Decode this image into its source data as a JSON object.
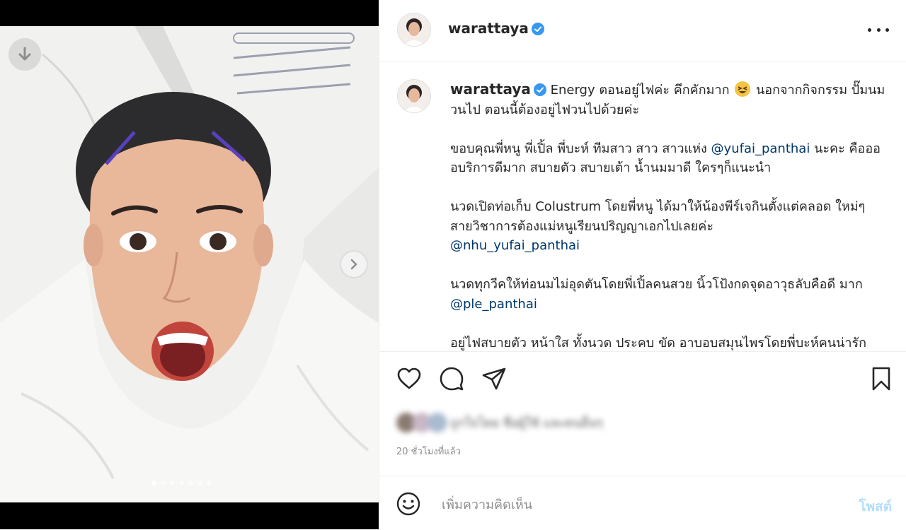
{
  "post": {
    "username": "warattaya",
    "more_label": "More options",
    "caption": {
      "p1_text": "Energy ตอนอยู่ไฟค่ะ คึกคักมาก",
      "p1_text_2": "นอกจากกิจกรรม ปั๊มนมวนไป ตอนนี้ต้องอยู่ไฟวนไปด้วยค่ะ",
      "p2_text": "ขอบคุณพี่หนู พี่เปิ้ล พี่บะห์ ทีมสาว สาว สาวแห่ง",
      "p2_mention": "@yufai_panthai",
      "p2_text_2": "นะคะ คืออออบริการดีมาก สบายตัว สบายเต้า น้ำนมมาดี ใครๆก็แนะนำ",
      "p3_text": "นวดเปิดท่อเก็บ Colustrum โดยพี่หนู ได้มาให้น้องพีร์เจกินตั้งแต่คลอด ใหม่ๆ สายวิชาการต้องแม่หนูเรียนปริญญาเอกไปเลยค่ะ",
      "p3_mention": "@nhu_yufai_panthai",
      "p4_text": "นวดทุกวีคให้ท่อนมไม่อุดตันโดยพี่เปิ้ลคนสวย นิ้วโป้งกดจุดอาวุธลับคือดี มาก",
      "p4_mention": "@ple_panthai",
      "p5_text": "อยู่ไฟสบายตัว หน้าใส ทั้งนวด ประคบ ขัด อาบอบสมุนไพรโดยพี่บะห์คนน่ารัก"
    },
    "likes_text": "ถูกใจโดย ชื่อผู้ใช้ และคนอื่นๆ",
    "timestamp": "20 ชั่วโมงที่แล้ว",
    "comment_placeholder": "เพิ่มความคิดเห็น",
    "post_button": "โพสต์",
    "carousel": {
      "total": 7,
      "active_index": 0
    }
  },
  "colors": {
    "verified": "#3897f0",
    "mention": "#00376b",
    "post_button": "#b2dffc",
    "timestamp": "#8e8e8e"
  },
  "icons": [
    "download-icon",
    "chevron-right-icon",
    "verified-badge-icon",
    "more-icon",
    "heart-icon",
    "comment-icon",
    "share-icon",
    "bookmark-icon",
    "emoji-icon"
  ]
}
